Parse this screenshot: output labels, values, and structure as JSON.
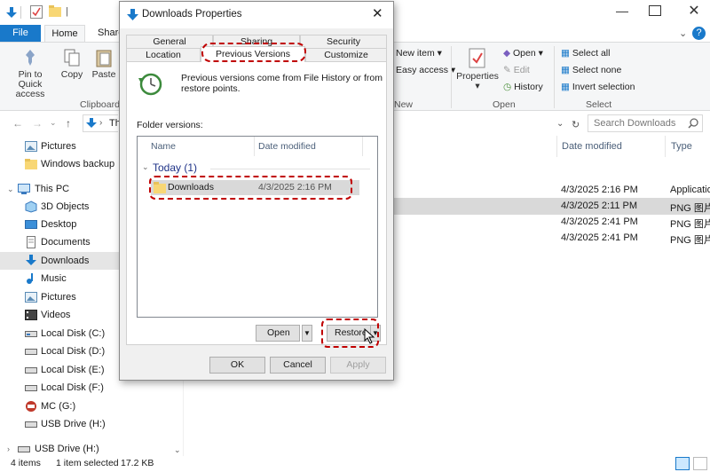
{
  "explorer": {
    "ribbon_tabs": {
      "file": "File",
      "home": "Home",
      "share": "Share"
    },
    "ribbon": {
      "pin_label_1": "Pin to Quick",
      "pin_label_2": "access",
      "copy": "Copy",
      "paste": "Paste",
      "clipboard_group": "Clipboard",
      "new_item": "New item",
      "easy_access": "Easy access",
      "new_group": "New",
      "properties": "Properties",
      "open": "Open",
      "edit": "Edit",
      "history": "History",
      "open_group": "Open",
      "select_all": "Select all",
      "select_none": "Select none",
      "invert_selection": "Invert selection",
      "select_group": "Select"
    },
    "address_partial": "Th",
    "search_placeholder": "Search Downloads",
    "nav_items": {
      "pictures_qa": "Pictures",
      "windows_backup": "Windows backup",
      "this_pc": "This PC",
      "objects_3d": "3D Objects",
      "desktop": "Desktop",
      "documents": "Documents",
      "downloads": "Downloads",
      "music": "Music",
      "pictures": "Pictures",
      "videos": "Videos",
      "disk_c": "Local Disk (C:)",
      "disk_d": "Local Disk (D:)",
      "disk_e": "Local Disk (E:)",
      "disk_f": "Local Disk (F:)",
      "mc_g": "MC (G:)",
      "usb_h": "USB Drive (H:)",
      "usb_h2": "USB Drive (H:)"
    },
    "columns": {
      "date_modified": "Date modified",
      "type": "Type"
    },
    "files": [
      {
        "date": "4/3/2025 2:16 PM",
        "type": "Applicatio"
      },
      {
        "date": "4/3/2025 2:11 PM",
        "type": "PNG 图片"
      },
      {
        "date": "4/3/2025 2:41 PM",
        "type": "PNG 图片"
      },
      {
        "date": "4/3/2025 2:41 PM",
        "type": "PNG 图片"
      }
    ],
    "status": {
      "items": "4 items",
      "selected": "1 item selected",
      "size": "17.2 KB"
    }
  },
  "dialog": {
    "title": "Downloads Properties",
    "tabs": {
      "general": "General",
      "sharing": "Sharing",
      "security": "Security",
      "location": "Location",
      "previous_versions": "Previous Versions",
      "customize": "Customize"
    },
    "info_text_1": "Previous versions come from File History or from",
    "info_text_2": "restore points.",
    "folder_versions_label": "Folder versions:",
    "list_headers": {
      "name": "Name",
      "date_modified": "Date modified"
    },
    "group_label": "Today (1)",
    "version_item": {
      "name": "Downloads",
      "date": "4/3/2025 2:16 PM"
    },
    "buttons": {
      "open": "Open",
      "restore": "Restore",
      "ok": "OK",
      "cancel": "Cancel",
      "apply": "Apply"
    }
  },
  "colors": {
    "accent": "#1979ca",
    "highlight_dash": "#c00000",
    "folder": "#f8d775",
    "selection": "#cce8ff"
  }
}
